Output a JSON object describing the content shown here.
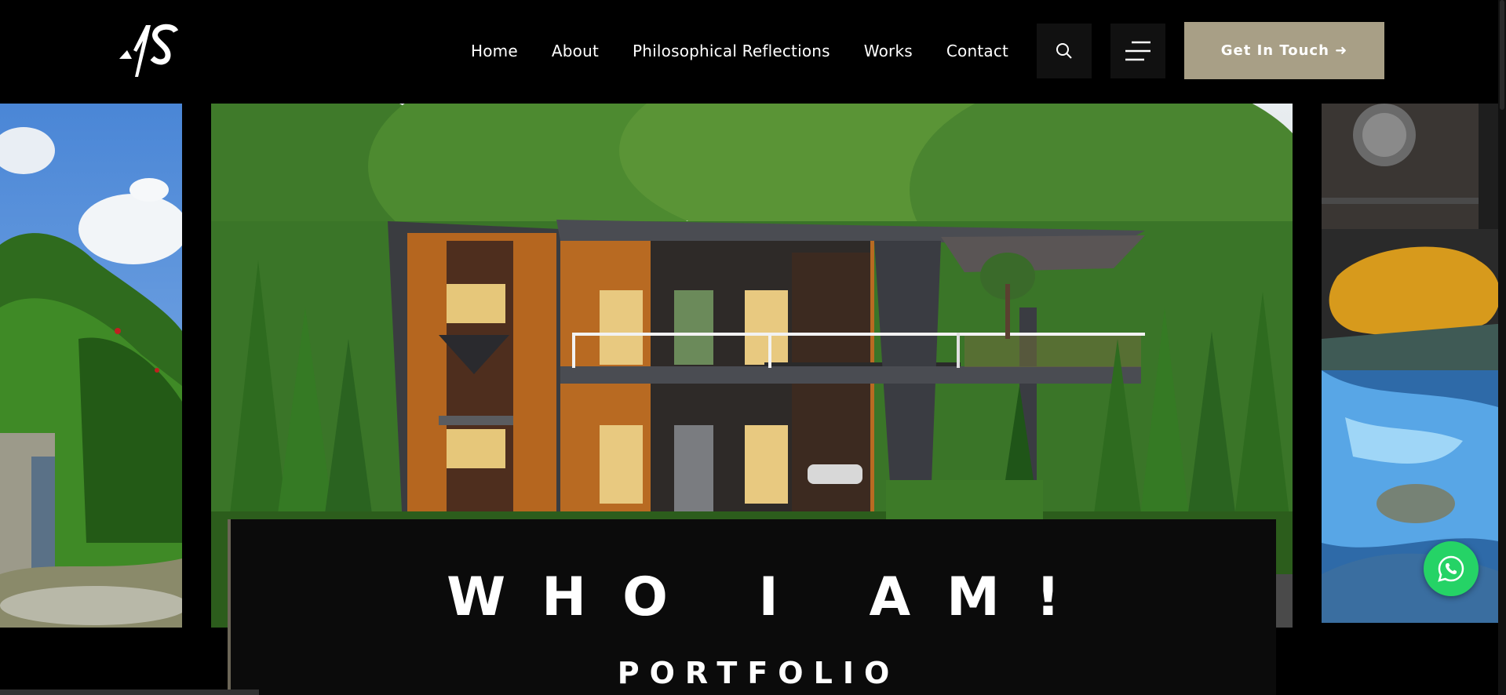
{
  "brand": {
    "logo_text": "AS"
  },
  "nav": {
    "items": [
      {
        "label": "Home"
      },
      {
        "label": "About"
      },
      {
        "label": "Philosophical Reflections"
      },
      {
        "label": "Works"
      },
      {
        "label": "Contact"
      }
    ],
    "search_icon": "search-icon",
    "menu_icon": "hamburger-icon",
    "cta_label": "Get In Touch ➜"
  },
  "hero": {
    "title": "WHO I AM!",
    "subtitle": "PORTFOLIO"
  },
  "colors": {
    "background": "#000000",
    "accent": "#a89f86",
    "panel": "#0b0b0b",
    "whatsapp": "#25d366"
  },
  "floating": {
    "whatsapp_icon": "whatsapp-icon"
  }
}
